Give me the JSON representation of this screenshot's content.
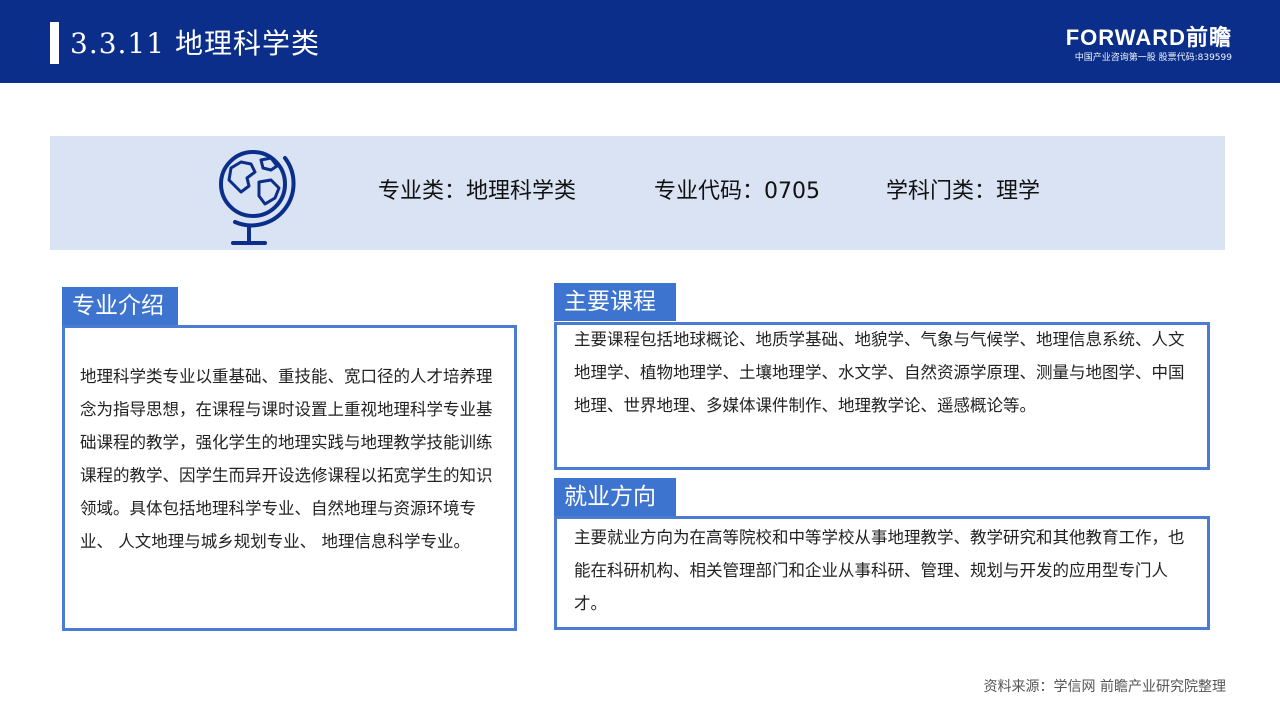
{
  "header": {
    "title": "3.3.11  地理科学类",
    "logo_main": "FORWARD前瞻",
    "logo_sub": "中国产业咨询第一股  股票代码:839599"
  },
  "info": {
    "major_class": "专业类：地理科学类",
    "major_code": "专业代码：0705",
    "discipline": "学科门类：理学"
  },
  "intro": {
    "tag": "专业介绍",
    "text": "地理科学类专业以重基础、重技能、宽口径的人才培养理念为指导思想，在课程与课时设置上重视地理科学专业基础课程的教学，强化学生的地理实践与地理教学技能训练课程的教学、因学生而异开设选修课程以拓宽学生的知识领域。具体包括地理科学专业、自然地理与资源环境专业、  人文地理与城乡规划专业、 地理信息科学专业。"
  },
  "courses": {
    "tag": "主要课程",
    "text": "主要课程包括地球概论、地质学基础、地貌学、气象与气候学、地理信息系统、人文地理学、植物地理学、土壤地理学、水文学、自然资源学原理、测量与地图学、中国地理、世界地理、多媒体课件制作、地理教学论、遥感概论等。"
  },
  "career": {
    "tag": "就业方向",
    "text": "主要就业方向为在高等院校和中等学校从事地理教学、教学研究和其他教育工作，也能在科研机构、相关管理部门和企业从事科研、管理、规划与开发的应用型专门人才。"
  },
  "footer": {
    "source": "资料来源：学信网 前瞻产业研究院整理"
  },
  "colors": {
    "header_bg": "#0b2e8a",
    "band_bg": "#dae3f3",
    "accent": "#3d74cf"
  },
  "icons": {
    "globe": "globe-stand-icon"
  }
}
